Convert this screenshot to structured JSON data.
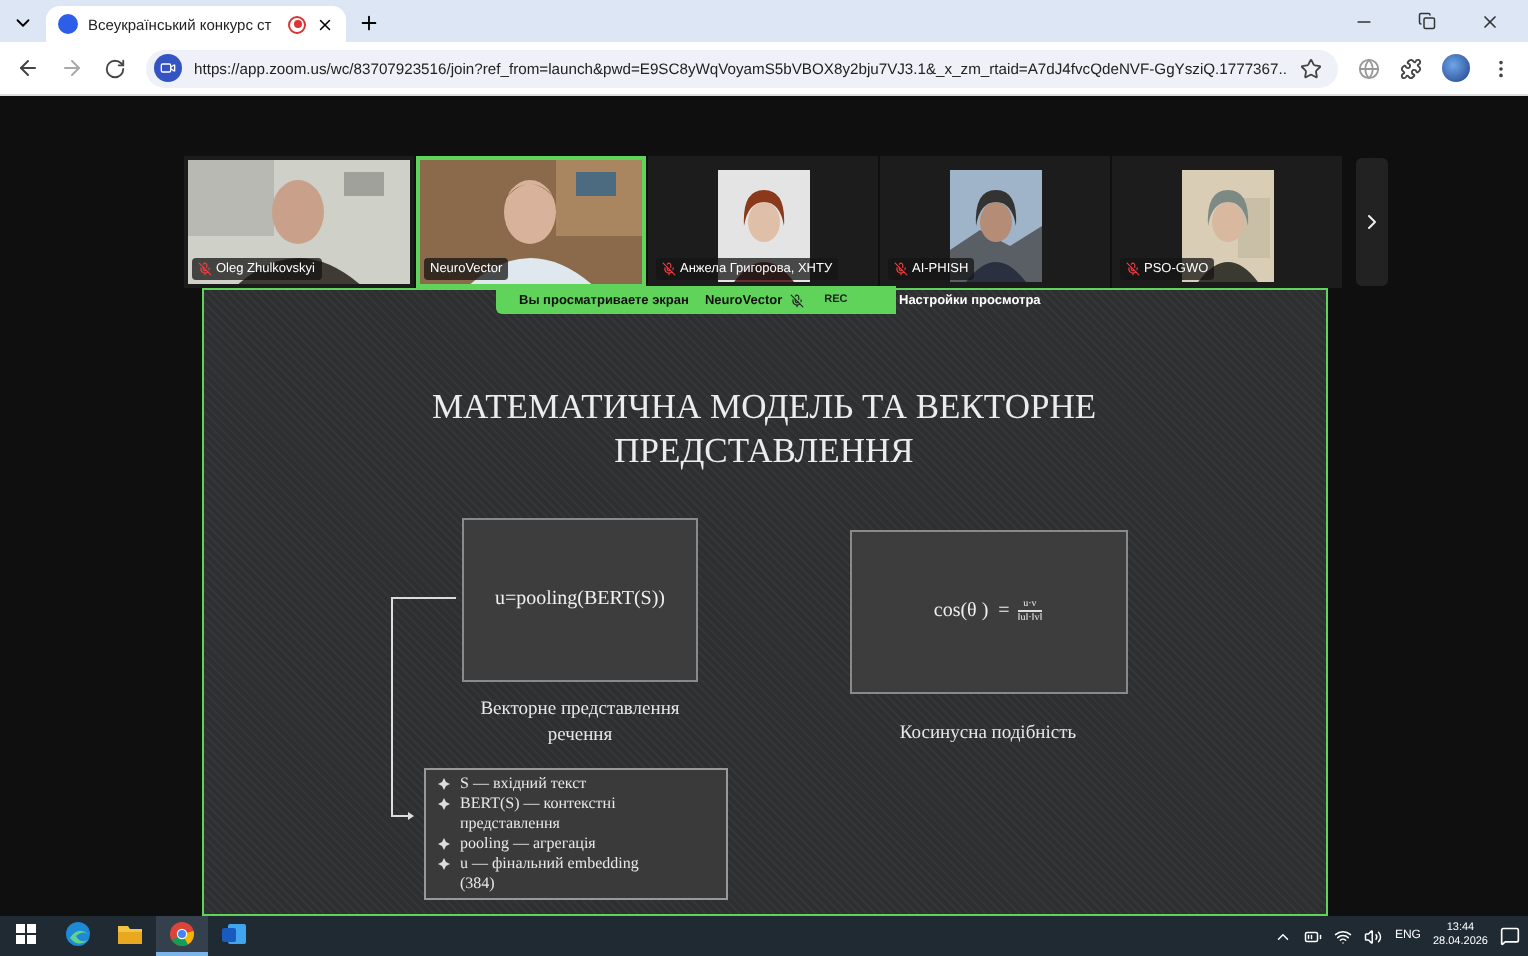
{
  "browser": {
    "tab": {
      "title": "Всеукраїнський конкурс ст",
      "recording": true
    },
    "address": "https://app.zoom.us/wc/83707923516/join?ref_from=launch&pwd=E9SC8yWqVoyamS5bVBOX8y2bju7VJ3.1&_x_zm_rtaid=A7dJ4fvcQdeNVF-GgYsziQ.1777367..."
  },
  "participants": [
    {
      "name": "Oleg Zhulkovskyi",
      "muted": true,
      "active": false,
      "kind": "video"
    },
    {
      "name": "NeuroVector",
      "muted": false,
      "active": true,
      "kind": "video"
    },
    {
      "name": "Анжела Григорова, ХНТУ",
      "muted": true,
      "active": false,
      "kind": "avatar"
    },
    {
      "name": "AI-PHISH",
      "muted": true,
      "active": false,
      "kind": "avatar"
    },
    {
      "name": "PSO-GWO",
      "muted": true,
      "active": false,
      "kind": "avatar"
    }
  ],
  "share_banner": {
    "text": "Вы просматриваете экран",
    "presenter": "NeuroVector",
    "presenter_muted": true,
    "rec": "REC",
    "settings": "Настройки просмотра"
  },
  "slide": {
    "title": "МАТЕМАТИЧНА МОДЕЛЬ ТА ВЕКТОРНЕ ПРЕДСТАВЛЕННЯ",
    "formula_left": "u=pooling(BERT(S))",
    "caption_left": "Векторне представлення речення",
    "bullets": [
      "S — вхідний текст",
      "BERT(S) — контекстні представлення",
      "pooling — агрегація",
      "u — фінальний embedding (384)"
    ],
    "formula_right": {
      "lhs": "cos(θ )  =",
      "numerator": "u·v",
      "denominator": "‖u‖·‖v‖"
    },
    "caption_right": "Косинусна подібність"
  },
  "taskbar": {
    "apps": [
      {
        "kind": "edge",
        "selected": false
      },
      {
        "kind": "folder",
        "selected": false
      },
      {
        "kind": "chrome",
        "selected": true
      },
      {
        "kind": "word",
        "selected": false
      }
    ],
    "language": "ENG",
    "time": "13:44",
    "date": "28.04.2026"
  }
}
